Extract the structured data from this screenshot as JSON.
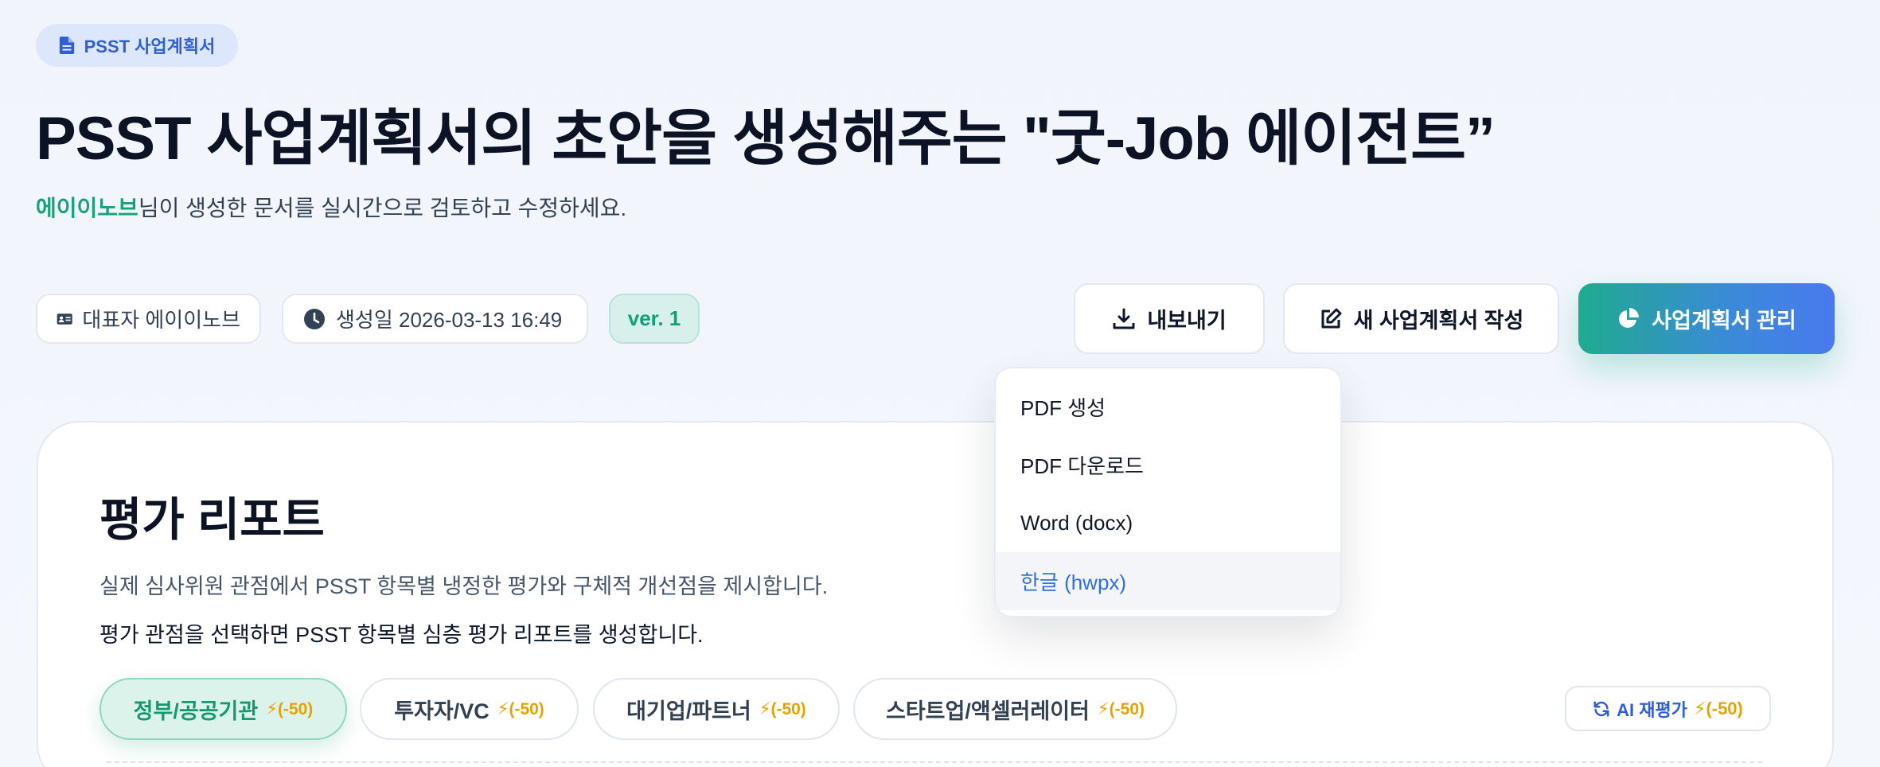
{
  "badge": {
    "label": "PSST 사업계획서",
    "icon": "document-icon"
  },
  "page": {
    "title": "PSST 사업계획서의 초안을 생성해주는 \"굿-Job 에이전트”",
    "subtitle_user": "에이이노브",
    "subtitle_rest": "님이 생성한 문서를 실시간으로 검토하고 수정하세요."
  },
  "meta": {
    "owner": "대표자 에이이노브",
    "created": "생성일 2026-03-13 16:49",
    "version": "ver. 1"
  },
  "actions": {
    "export": "내보내기",
    "new_plan": "새 사업계획서 작성",
    "manage": "사업계획서 관리"
  },
  "export_menu": {
    "items": [
      "PDF 생성",
      "PDF 다운로드",
      "Word (docx)",
      "한글 (hwpx)"
    ],
    "active_index": 3
  },
  "report": {
    "title": "평가 리포트",
    "desc1": "실제 심사위원 관점에서 PSST 항목별 냉정한 평가와 구체적 개선점을 제시합니다.",
    "desc2": "평가 관점을 선택하면 PSST 항목별 심층 평가 리포트를 생성합니다.",
    "perspectives": [
      {
        "label": "정부/공공기관",
        "cost": "⚡(-50)"
      },
      {
        "label": "투자자/VC",
        "cost": "⚡(-50)"
      },
      {
        "label": "대기업/파트너",
        "cost": "⚡(-50)"
      },
      {
        "label": "스타트업/액셀러레이터",
        "cost": "⚡(-50)"
      }
    ],
    "reevaluate": {
      "label": "AI 재평가",
      "cost": "⚡(-50)"
    }
  },
  "colors": {
    "accent_green": "#16a37b",
    "accent_blue": "#2f5fd7",
    "cost_yellow": "#e6a300"
  }
}
